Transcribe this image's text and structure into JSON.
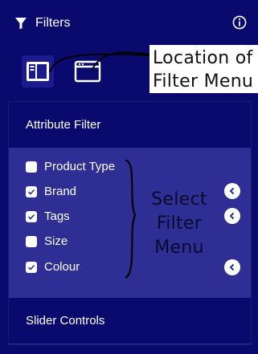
{
  "header": {
    "title": "Filters"
  },
  "annotations": {
    "location_line1": "Location of",
    "location_line2": "Filter Menu",
    "select_line1": "Select",
    "select_line2": "Filter",
    "select_line3": "Menu"
  },
  "attribute_filter": {
    "title": "Attribute Filter",
    "options": [
      {
        "label": "Product Type",
        "checked": false,
        "has_chevron": false
      },
      {
        "label": "Brand",
        "checked": true,
        "has_chevron": true
      },
      {
        "label": "Tags",
        "checked": true,
        "has_chevron": true
      },
      {
        "label": "Size",
        "checked": false,
        "has_chevron": false
      },
      {
        "label": "Colour",
        "checked": true,
        "has_chevron": true
      }
    ]
  },
  "slider_controls": {
    "title": "Slider Controls"
  },
  "icons": {
    "filter": "filter-funnel-icon",
    "info": "info-circle-icon",
    "sidebar_layout": "sidebar-layout-icon",
    "top_layout": "window-layout-icon",
    "chevron": "chevron-left-circle-icon"
  },
  "colors": {
    "background": "#0a0a6e",
    "panel": "#2e2e95",
    "text": "#ffffff"
  }
}
